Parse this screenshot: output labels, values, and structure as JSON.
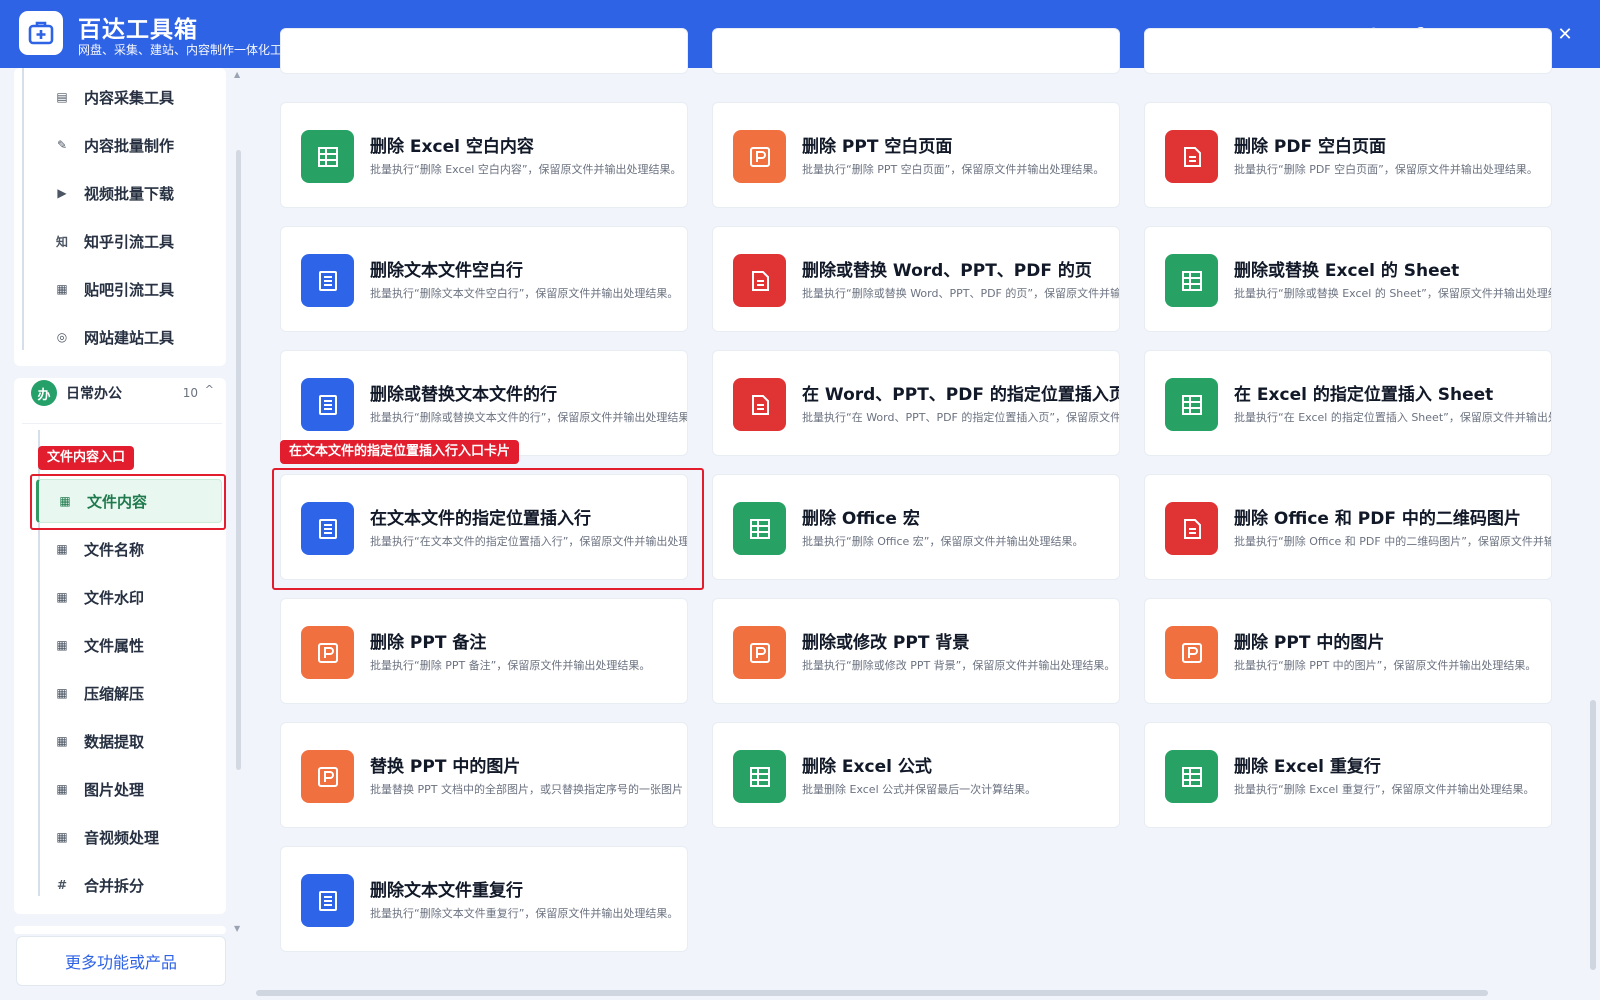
{
  "app": {
    "title": "百达工具箱",
    "subtitle": "网盘、采集、建站、内容制作一体化工作台"
  },
  "window_controls": [
    "settings",
    "help",
    "minimize",
    "maximize",
    "close"
  ],
  "window_glyphs": {
    "help": "?",
    "minimize": "-",
    "close": "✕"
  },
  "sidebar": {
    "top_items": [
      {
        "label": "内容采集工具",
        "icon": "clipboard-icon"
      },
      {
        "label": "内容批量制作",
        "icon": "pen-icon"
      },
      {
        "label": "视频批量下载",
        "icon": "video-icon"
      },
      {
        "label": "知乎引流工具",
        "icon": "zhihu-icon"
      },
      {
        "label": "贴吧引流工具",
        "icon": "tieba-icon"
      },
      {
        "label": "网站建站工具",
        "icon": "globe-icon"
      }
    ],
    "group": {
      "badge": "办",
      "name": "日常办公",
      "count": "10",
      "caret": "^"
    },
    "group_items": [
      {
        "label": "文件内容",
        "icon": "grid-icon",
        "active": true
      },
      {
        "label": "文件名称",
        "icon": "grid-icon"
      },
      {
        "label": "文件水印",
        "icon": "grid-icon"
      },
      {
        "label": "文件属性",
        "icon": "grid-icon"
      },
      {
        "label": "压缩解压",
        "icon": "grid-icon"
      },
      {
        "label": "数据提取",
        "icon": "grid-icon"
      },
      {
        "label": "图片处理",
        "icon": "grid-icon"
      },
      {
        "label": "音视频处理",
        "icon": "grid-icon"
      },
      {
        "label": "合并拆分",
        "icon": "hash-icon"
      }
    ],
    "more_button": "更多功能或产品"
  },
  "annotations": {
    "sidebar_label": "文件内容入口",
    "card_label": "在文本文件的指定位置插入行入口卡片"
  },
  "cards": [
    {
      "title": "删除 Excel 空白内容",
      "desc": "批量执行“删除 Excel 空白内容”，保留原文件并输出处理结果。",
      "color": "green"
    },
    {
      "title": "删除 PPT 空白页面",
      "desc": "批量执行“删除 PPT 空白页面”，保留原文件并输出处理结果。",
      "color": "orange"
    },
    {
      "title": "删除 PDF 空白页面",
      "desc": "批量执行“删除 PDF 空白页面”，保留原文件并输出处理结果。",
      "color": "red"
    },
    {
      "title": "删除文本文件空白行",
      "desc": "批量执行“删除文本文件空白行”，保留原文件并输出处理结果。",
      "color": "blue"
    },
    {
      "title": "删除或替换 Word、PPT、PDF 的页",
      "desc": "批量执行“删除或替换 Word、PPT、PDF 的页”，保留原文件并输",
      "color": "red"
    },
    {
      "title": "删除或替换 Excel 的 Sheet",
      "desc": "批量执行“删除或替换 Excel 的 Sheet”，保留原文件并输出处理结果",
      "color": "green"
    },
    {
      "title": "删除或替换文本文件的行",
      "desc": "批量执行“删除或替换文本文件的行”，保留原文件并输出处理结果",
      "color": "blue"
    },
    {
      "title": "在 Word、PPT、PDF 的指定位置插入页",
      "desc": "批量执行“在 Word、PPT、PDF 的指定位置插入页”，保留原文件",
      "color": "red"
    },
    {
      "title": "在 Excel 的指定位置插入 Sheet",
      "desc": "批量执行“在 Excel 的指定位置插入 Sheet”，保留原文件并输出处理",
      "color": "green"
    },
    {
      "title": "在文本文件的指定位置插入行",
      "desc": "批量执行“在文本文件的指定位置插入行”，保留原文件并输出处理",
      "color": "blue"
    },
    {
      "title": "删除 Office 宏",
      "desc": "批量执行“删除 Office 宏”，保留原文件并输出处理结果。",
      "color": "green"
    },
    {
      "title": "删除 Office 和 PDF 中的二维码图片",
      "desc": "批量执行“删除 Office 和 PDF 中的二维码图片”，保留原文件并输出",
      "color": "red"
    },
    {
      "title": "删除 PPT 备注",
      "desc": "批量执行“删除 PPT 备注”，保留原文件并输出处理结果。",
      "color": "orange"
    },
    {
      "title": "删除或修改 PPT 背景",
      "desc": "批量执行“删除或修改 PPT 背景”，保留原文件并输出处理结果。",
      "color": "orange"
    },
    {
      "title": "删除 PPT 中的图片",
      "desc": "批量执行“删除 PPT 中的图片”，保留原文件并输出处理结果。",
      "color": "orange"
    },
    {
      "title": "替换 PPT 中的图片",
      "desc": "批量替换 PPT 文档中的全部图片，或只替换指定序号的一张图片",
      "color": "orange"
    },
    {
      "title": "删除 Excel 公式",
      "desc": "批量删除 Excel 公式并保留最后一次计算结果。",
      "color": "green"
    },
    {
      "title": "删除 Excel 重复行",
      "desc": "批量执行“删除 Excel 重复行”，保留原文件并输出处理结果。",
      "color": "green"
    },
    {
      "title": "删除文本文件重复行",
      "desc": "批量执行“删除文本文件重复行”，保留原文件并输出处理结果。",
      "color": "blue"
    }
  ]
}
